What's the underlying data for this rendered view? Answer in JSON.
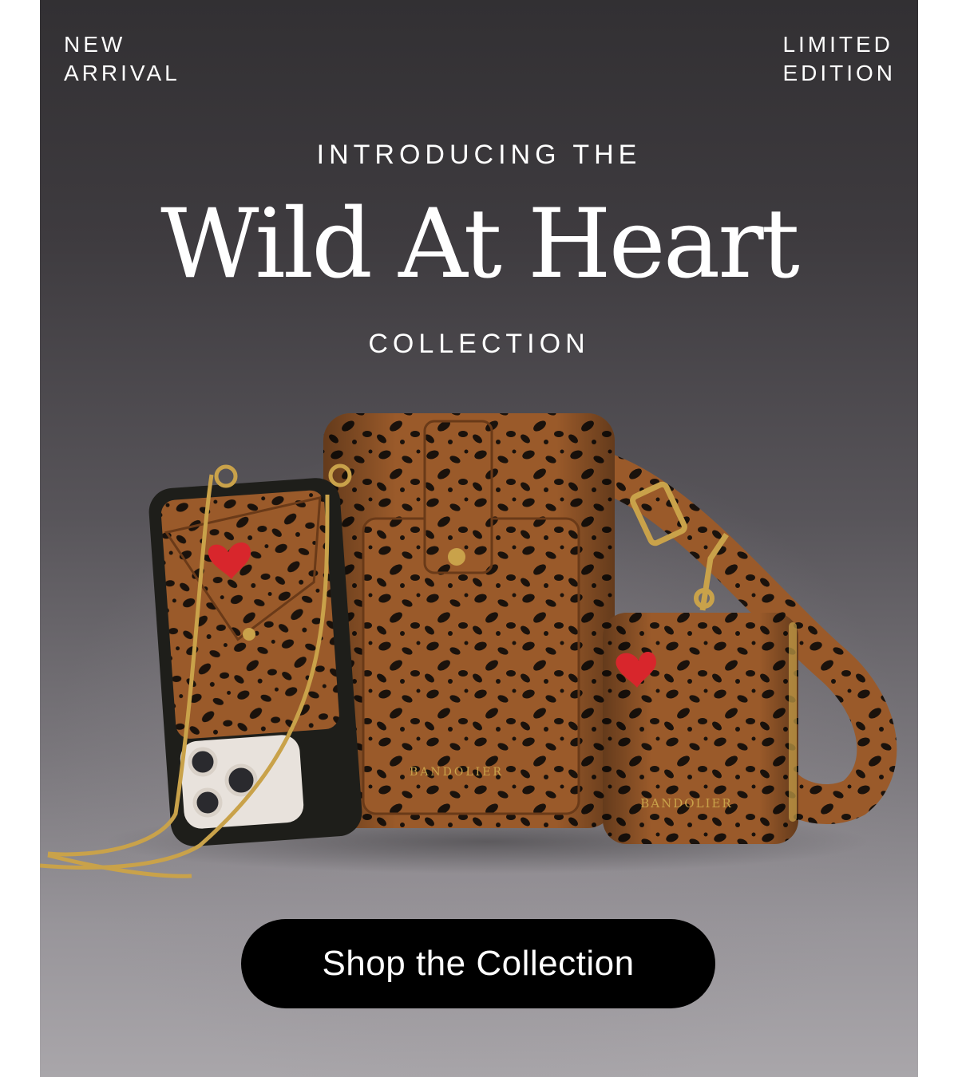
{
  "banner": {
    "corner_left": "NEW\nARRIVAL",
    "corner_right": "LIMITED\nEDITION",
    "eyebrow_top": "INTRODUCING THE",
    "title": "Wild At Heart",
    "eyebrow_bottom": "COLLECTION",
    "cta_label": "Shop the Collection"
  },
  "products": {
    "brand_mark_main": "BANDOLIER",
    "brand_mark_pouch": "BANDOLIER",
    "pattern": "leopard",
    "accent_icon": "heart-icon"
  },
  "colors": {
    "background_dark": "#323033",
    "background_light": "#a9a6aa",
    "leather": "#9a5a2a",
    "spots": "#1a120c",
    "heart": "#d8262c",
    "gold": "#c9a24a",
    "cta_bg": "#000000",
    "text": "#ffffff"
  }
}
